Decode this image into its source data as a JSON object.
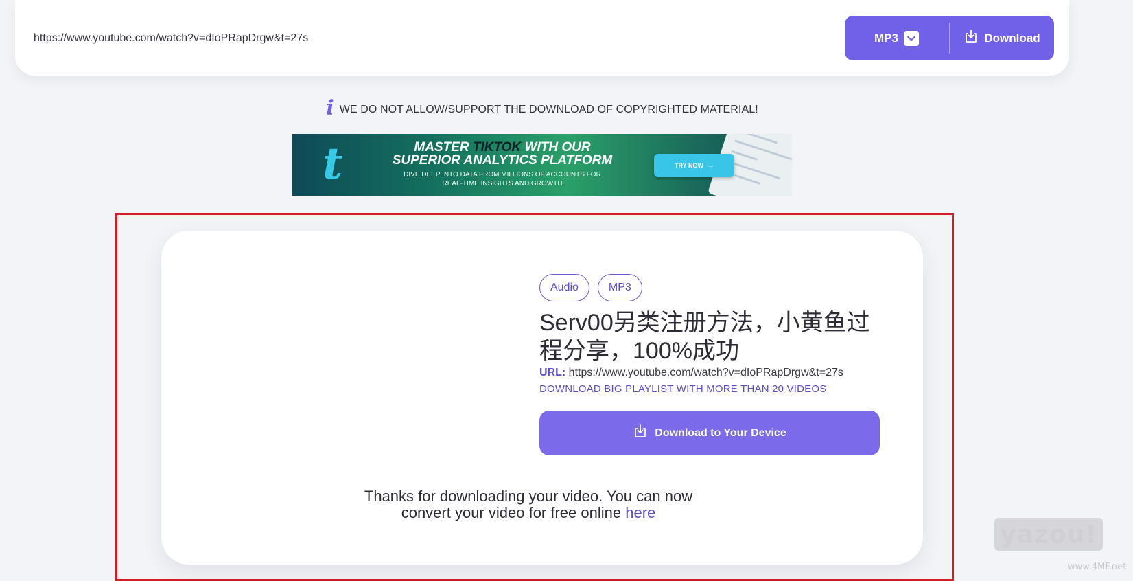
{
  "search_bar": {
    "url_value": "https://www.youtube.com/watch?v=dIoPRapDrgw&t=27s",
    "format_selected": "MP3",
    "download_label": "Download"
  },
  "notice": {
    "icon": "i",
    "text": "WE DO NOT ALLOW/SUPPORT THE DOWNLOAD OF COPYRIGHTED MATERIAL!"
  },
  "banner": {
    "headline_pre": "MASTER ",
    "headline_highlight": "TIKTOK",
    "headline_post": " WITH OUR",
    "headline_line2": "SUPERIOR ANALYTICS PLATFORM",
    "subtext_line1": "DIVE DEEP INTO DATA FROM MILLIONS OF ACCOUNTS FOR",
    "subtext_line2": "REAL-TIME INSIGHTS AND GROWTH",
    "cta_label": "TRY NOW",
    "accent_color": "#39c5e8"
  },
  "result": {
    "tags": [
      "Audio",
      "MP3"
    ],
    "title": "Serv00另类注册方法，小黄鱼过程分享，100%成功",
    "url_label": "URL:",
    "url_value": "https://www.youtube.com/watch?v=dIoPRapDrgw&t=27s",
    "playlist_link": "DOWNLOAD BIG PLAYLIST WITH MORE THAN 20 VIDEOS",
    "download_button": "Download to Your Device",
    "thanks_line1": "Thanks for downloading your video. You can now",
    "thanks_line2": "convert your video for free online",
    "thanks_link": "here"
  },
  "watermark": {
    "brand": "yazou!",
    "site": "www.4MF.net"
  },
  "colors": {
    "accent": "#7160e8",
    "highlight_border": "#d21f24",
    "page_bg": "#f3f4f8"
  }
}
